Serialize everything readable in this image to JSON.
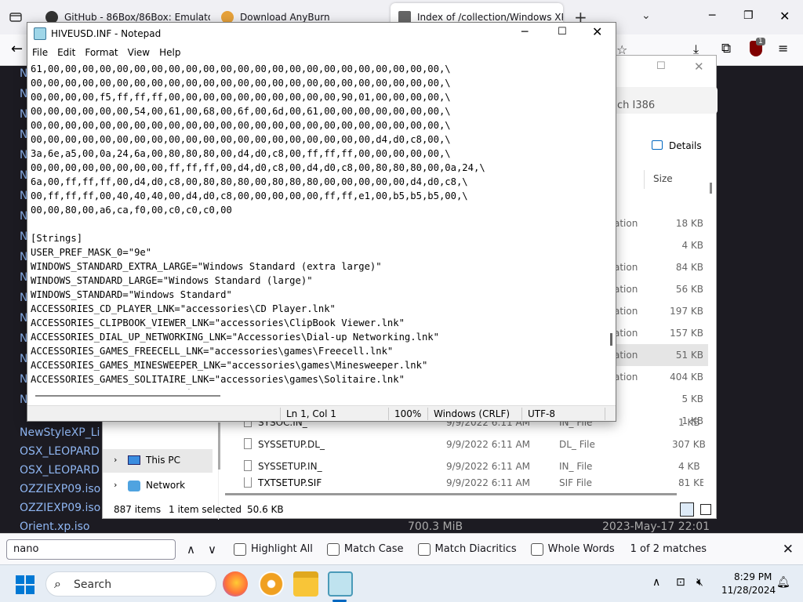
{
  "browser": {
    "tabs": [
      {
        "title": "GitHub - 86Box/86Box: Emulator"
      },
      {
        "title": "Download AnyBurn"
      },
      {
        "title": "Index of /collection/Windows XP"
      }
    ],
    "new_tab": "+",
    "extension_badge": "1"
  },
  "page": {
    "links": [
      "NewStyleXP_Li",
      "OSX_LEOPARD",
      "OSX_LEOPARD",
      "OZZIEXP09.iso",
      "OZZIEXP09.iso",
      "Orient.xp.iso"
    ],
    "last_size": "700.3 MiB",
    "last_date": "2023-May-17 22:01"
  },
  "findbar": {
    "query": "nano",
    "highlight_all": "Highlight All",
    "match_case": "Match Case",
    "match_diacritics": "Match Diacritics",
    "whole_words": "Whole Words",
    "result": "1 of 2 matches"
  },
  "explorer": {
    "search_hint": "ch I386",
    "details_label": "Details",
    "size_header": "Size",
    "partial_rows": [
      {
        "type": "ation",
        "size": "18 KB"
      },
      {
        "type": "",
        "size": "4 KB"
      },
      {
        "type": "ation",
        "size": "84 KB"
      },
      {
        "type": "ation",
        "size": "56 KB"
      },
      {
        "type": "ation",
        "size": "197 KB"
      },
      {
        "type": "ation",
        "size": "157 KB"
      },
      {
        "type": "ation",
        "size": "51 KB"
      },
      {
        "type": "ation",
        "size": "404 KB"
      },
      {
        "type": "",
        "size": "5 KB"
      },
      {
        "type": "",
        "size": "1 KB"
      }
    ],
    "nav": {
      "this_pc": "This PC",
      "network": "Network"
    },
    "rows": [
      {
        "name": "SYSOC.IN_",
        "date": "9/9/2022 6:11 AM",
        "type": "IN_ File",
        "size": "1 KB"
      },
      {
        "name": "SYSSETUP.DL_",
        "date": "9/9/2022 6:11 AM",
        "type": "DL_ File",
        "size": "307 KB"
      },
      {
        "name": "SYSSETUP.IN_",
        "date": "9/9/2022 6:11 AM",
        "type": "IN_ File",
        "size": "4 KB"
      },
      {
        "name": "TXTSETUP.SIF",
        "date": "9/9/2022 6:11 AM",
        "type": "SIF File",
        "size": "81 KB"
      }
    ],
    "status": {
      "count": "887 items",
      "selected": "1 item selected",
      "selected_size": "50.6 KB"
    }
  },
  "notepad": {
    "title": "HIVEUSD.INF - Notepad",
    "menu": [
      "File",
      "Edit",
      "Format",
      "View",
      "Help"
    ],
    "lines": [
      "61,00,00,00,00,00,00,00,00,00,00,00,00,00,00,00,00,00,00,00,00,00,00,00,\\",
      "00,00,00,00,00,00,00,00,00,00,00,00,00,00,00,00,00,00,00,00,00,00,00,00,\\",
      "00,00,00,00,f5,ff,ff,ff,00,00,00,00,00,00,00,00,00,00,90,01,00,00,00,00,\\",
      "00,00,00,00,00,00,54,00,61,00,68,00,6f,00,6d,00,61,00,00,00,00,00,00,00,\\",
      "00,00,00,00,00,00,00,00,00,00,00,00,00,00,00,00,00,00,00,00,00,00,00,00,\\",
      "00,00,00,00,00,00,00,00,00,00,00,00,00,00,00,00,00,00,00,00,d4,d0,c8,00,\\",
      "3a,6e,a5,00,0a,24,6a,00,80,80,80,00,d4,d0,c8,00,ff,ff,ff,00,00,00,00,00,\\",
      "00,00,00,00,00,00,00,00,ff,ff,ff,00,d4,d0,c8,00,d4,d0,c8,00,80,80,80,00,0a,24,\\",
      "6a,00,ff,ff,ff,00,d4,d0,c8,00,80,80,80,00,80,80,80,00,00,00,00,00,d4,d0,c8,\\",
      "00,ff,ff,ff,00,40,40,40,00,d4,d0,c8,00,00,00,00,00,ff,ff,e1,00,b5,b5,b5,00,\\",
      "00,00,80,00,a6,ca,f0,00,c0,c0,c0,00",
      "",
      "[Strings]",
      "USER_PREF_MASK_0=\"9e\"",
      "WINDOWS_STANDARD_EXTRA_LARGE=\"Windows Standard (extra large)\"",
      "WINDOWS_STANDARD_LARGE=\"Windows Standard (large)\"",
      "WINDOWS_STANDARD=\"Windows Standard\"",
      "ACCESSORIES_CD_PLAYER_LNK=\"accessories\\CD Player.lnk\"",
      "ACCESSORIES_CLIPBOOK_VIEWER_LNK=\"accessories\\ClipBook Viewer.lnk\"",
      "ACCESSORIES_DIAL_UP_NETWORKING_LNK=\"Accessories\\Dial-up Networking.lnk\"",
      "ACCESSORIES_GAMES_FREECELL_LNK=\"accessories\\games\\Freecell.lnk\"",
      "ACCESSORIES_GAMES_MINESWEEPER_LNK=\"accessories\\games\\Minesweeper.lnk\"",
      "ACCESSORIES_GAMES_SOLITAIRE_LNK=\"accessories\\games\\Solitaire.lnk\"",
      "ACCESSORIES_GAMES_\"Accessories\\Games"
    ],
    "status": {
      "position": "Ln 1, Col 1",
      "zoom": "100%",
      "line_endings": "Windows (CRLF)",
      "encoding": "UTF-8"
    }
  },
  "taskbar": {
    "search_label": "Search",
    "time": "8:29 PM",
    "date": "11/28/2024"
  },
  "colors": {
    "accent": "#0067c0",
    "link": "#8fb6f2",
    "taskbar": "#e6edf5"
  }
}
